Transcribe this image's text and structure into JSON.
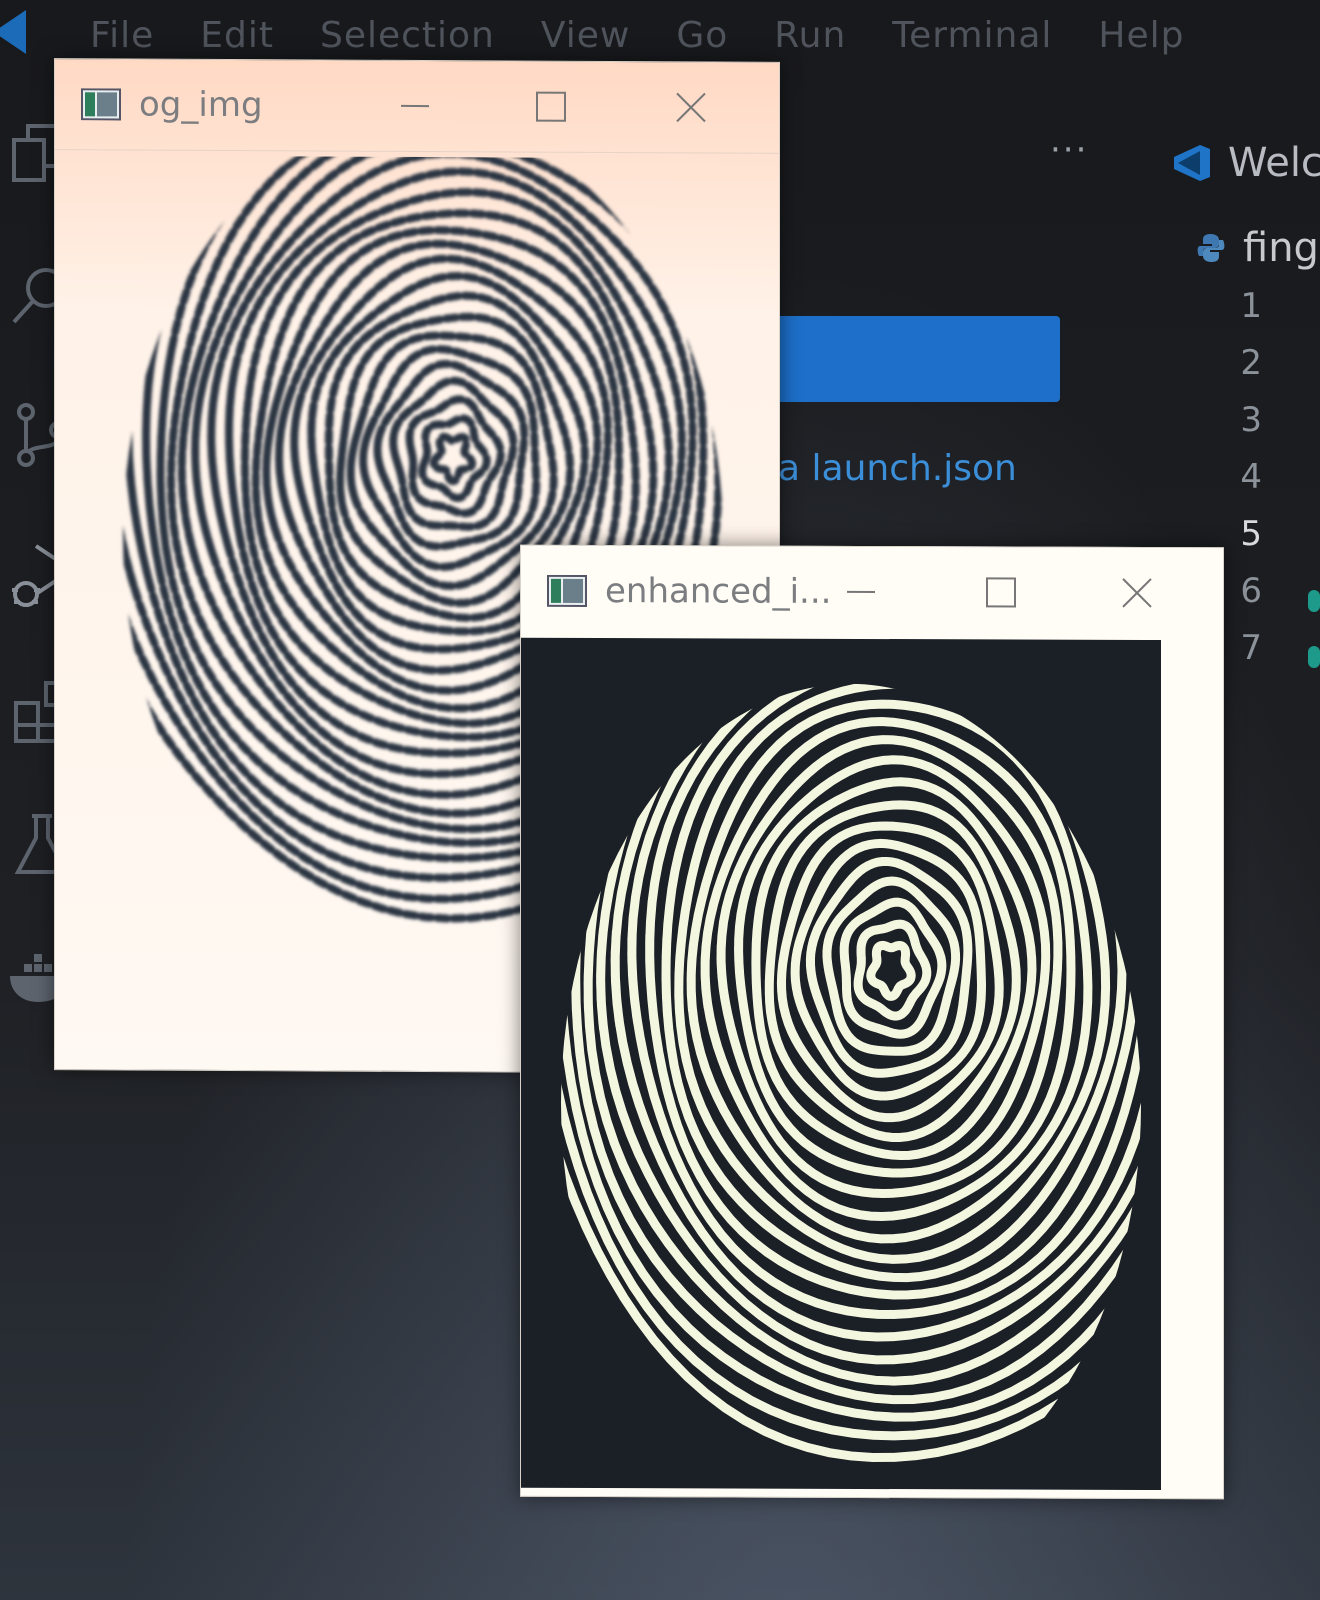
{
  "menubar": {
    "items": [
      "File",
      "Edit",
      "Selection",
      "View",
      "Go",
      "Run",
      "Terminal",
      "Help"
    ]
  },
  "activitybar": {
    "icons": [
      "explorer-icon",
      "search-icon",
      "source-control-icon",
      "run-debug-icon",
      "extensions-icon",
      "testing-icon",
      "docker-icon"
    ]
  },
  "editor": {
    "more_actions": "···",
    "tab_label": "Welc",
    "file_label": "fing",
    "line_numbers": [
      "1",
      "2",
      "3",
      "4",
      "5",
      "6",
      "7"
    ],
    "launch_link": "a launch.json"
  },
  "windows": {
    "og": {
      "title": "og_img"
    },
    "enhanced": {
      "title": "enhanced_i..."
    }
  },
  "colors": {
    "accent_blue": "#1d6fc9",
    "link_blue": "#3b8ed8",
    "editor_bg": "#1c1d20",
    "ridge_white": "#f4f7df",
    "ridge_dark": "#2b3442"
  }
}
